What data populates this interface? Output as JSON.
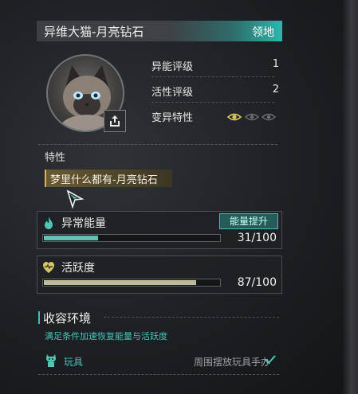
{
  "header": {
    "title": "异维大猫-月亮钻石",
    "tag": "领地"
  },
  "stats": [
    {
      "label": "异能评级",
      "value": "1"
    },
    {
      "label": "活性评级",
      "value": "2"
    },
    {
      "label": "变异特性",
      "eyes_active": 1,
      "eyes_total": 3
    }
  ],
  "trait": {
    "section_label": "特性",
    "tag": "梦里什么都有-月亮钻石"
  },
  "energy": {
    "label": "异常能量",
    "boost_label": "能量提升",
    "value_text": "31/100",
    "fill_fraction": 0.31
  },
  "activity": {
    "label": "活跃度",
    "value_text": "87/100",
    "fill_fraction": 0.87
  },
  "environment": {
    "title": "收容环境",
    "description": "满足条件加速恢复能量与活跃度",
    "item_label": "玩具",
    "item_desc": "周围摆放玩具手办"
  },
  "colors": {
    "accent": "#3fbfb0",
    "energy_bar": "#5ec4b1",
    "activity_bar": "#bdbb99",
    "trait_gold": "#d9b45a"
  }
}
